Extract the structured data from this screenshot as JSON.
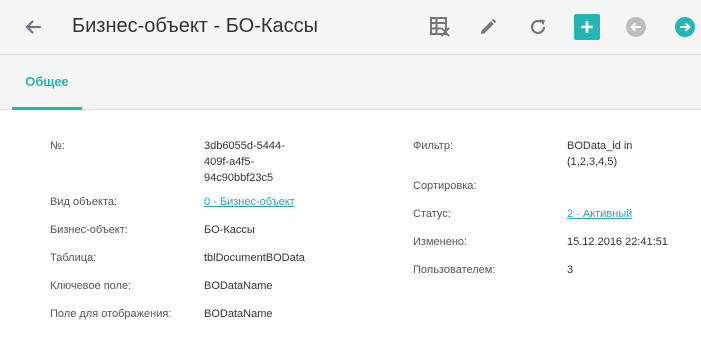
{
  "header": {
    "title": "Бизнес-объект - БО-Кассы"
  },
  "tabs": [
    {
      "label": "Общее",
      "active": true
    }
  ],
  "colors": {
    "accent": "#26b4b6",
    "add_button_bg": "#26b4b6",
    "disabled_nav": "#bdbdbd"
  },
  "icons": [
    "arrow-left-icon",
    "table-remove-icon",
    "pencil-icon",
    "refresh-icon",
    "plus-icon",
    "prev-record-icon",
    "next-record-icon"
  ],
  "fields_left": [
    {
      "label": "№:",
      "value_lines": [
        "3db6055d-5444-",
        "409f-a4f5-",
        "94c90bbf23c5"
      ]
    },
    {
      "label": "Вид объекта:",
      "value": "0 - Бизнес-объект",
      "link": true
    },
    {
      "label": "Бизнес-объект:",
      "value": "БО-Кассы"
    },
    {
      "label": "Таблица:",
      "value": "tblDocumentBOData"
    },
    {
      "label": "Ключевое поле:",
      "value": "BODataName"
    },
    {
      "label": "Поле для отображения:",
      "value": "BODataName"
    }
  ],
  "fields_right": [
    {
      "label": "Фильтр:",
      "value_lines": [
        "BOData_id in",
        "(1,2,3,4,5)"
      ]
    },
    {
      "label": "Сортировка:",
      "value": ""
    },
    {
      "label": "Статус:",
      "value": "2 - Активный",
      "link": true
    },
    {
      "label": "Изменено:",
      "value": "15.12.2016 22:41:51"
    },
    {
      "label": "Пользователем:",
      "value": "3"
    }
  ]
}
